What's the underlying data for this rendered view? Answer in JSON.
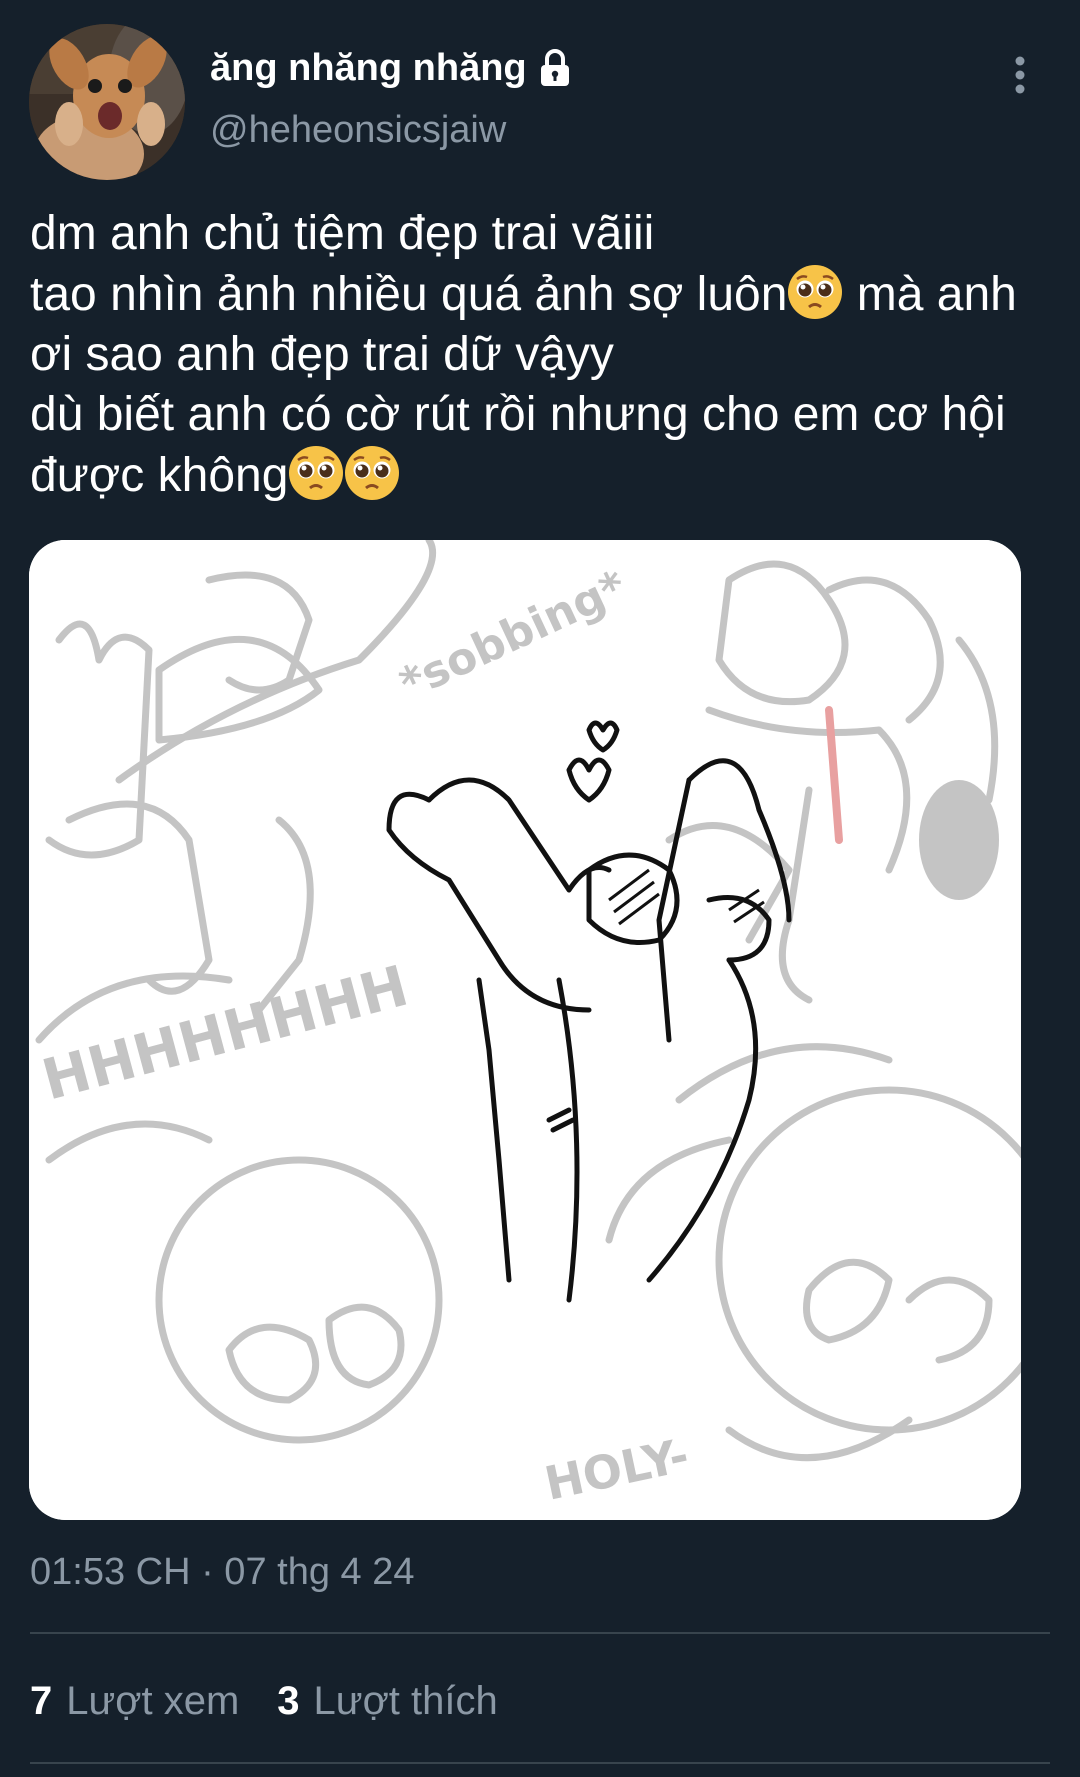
{
  "user": {
    "display_name": "ăng nhăng nhăng",
    "handle": "@heheonsicsjaiw",
    "protected_icon": "lock-icon"
  },
  "tweet": {
    "line1": "dm anh chủ tiệm đẹp trai vãiii",
    "line2a": "tao nhìn ảnh nhiều quá ảnh sợ luôn",
    "line2b": " mà anh",
    "line3": "ơi sao anh đẹp trai dữ vậyy",
    "line4": "dù biết anh có cờ rút rồi nhưng cho em cơ hội",
    "line5": "được không",
    "emoji": "pleading-face-emoji"
  },
  "media": {
    "texts": {
      "sobbing": "*sobbing*",
      "scream": "HHHHHHHH",
      "holy": "HOLY-"
    }
  },
  "timestamp": "01:53 CH · 07 thg 4 24",
  "stats": {
    "views_count": "7",
    "views_label": "Lượt xem",
    "likes_count": "3",
    "likes_label": "Lượt thích"
  },
  "colors": {
    "background": "#15202b",
    "primary_text": "#ffffff",
    "secondary_text": "#8b98a5",
    "divider": "#38444d"
  }
}
